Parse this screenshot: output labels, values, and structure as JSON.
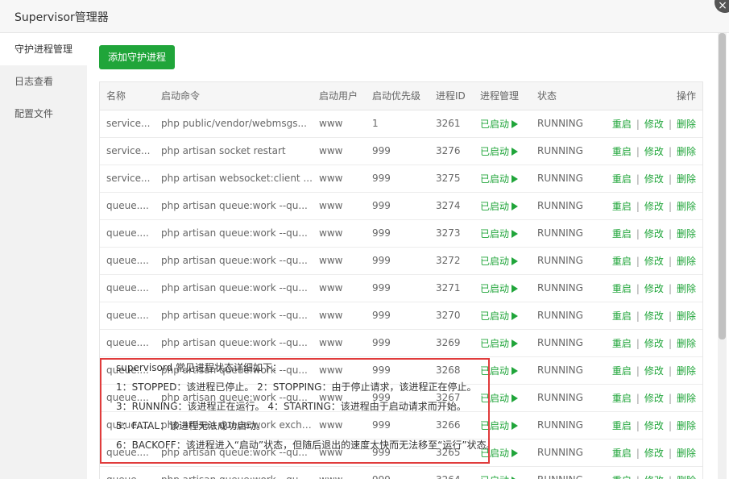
{
  "window": {
    "title": "Supervisor管理器",
    "close_icon": "×"
  },
  "sidebar": {
    "items": [
      {
        "label": "守护进程管理",
        "active": true
      },
      {
        "label": "日志查看"
      },
      {
        "label": "配置文件"
      }
    ]
  },
  "toolbar": {
    "add_label": "添加守护进程"
  },
  "table": {
    "headers": [
      "名称",
      "启动命令",
      "启动用户",
      "启动优先级",
      "进程ID",
      "进程管理",
      "状态",
      "操作"
    ],
    "ops": {
      "restart": "重启",
      "edit": "修改",
      "delete": "删除",
      "sep": "|"
    },
    "rows": [
      {
        "name": "service...",
        "cmd": "php public/vendor/webmsgs...",
        "user": "www",
        "priority": "1",
        "pid": "3261",
        "manage": "已启动",
        "status": "RUNNING"
      },
      {
        "name": "service...",
        "cmd": "php artisan socket restart",
        "user": "www",
        "priority": "999",
        "pid": "3276",
        "manage": "已启动",
        "status": "RUNNING"
      },
      {
        "name": "service...",
        "cmd": "php artisan websocket:client ...",
        "user": "www",
        "priority": "999",
        "pid": "3275",
        "manage": "已启动",
        "status": "RUNNING"
      },
      {
        "name": "queue....",
        "cmd": "php artisan queue:work --qu...",
        "user": "www",
        "priority": "999",
        "pid": "3274",
        "manage": "已启动",
        "status": "RUNNING"
      },
      {
        "name": "queue....",
        "cmd": "php artisan queue:work --qu...",
        "user": "www",
        "priority": "999",
        "pid": "3273",
        "manage": "已启动",
        "status": "RUNNING"
      },
      {
        "name": "queue....",
        "cmd": "php artisan queue:work --qu...",
        "user": "www",
        "priority": "999",
        "pid": "3272",
        "manage": "已启动",
        "status": "RUNNING"
      },
      {
        "name": "queue....",
        "cmd": "php artisan queue:work --qu...",
        "user": "www",
        "priority": "999",
        "pid": "3271",
        "manage": "已启动",
        "status": "RUNNING"
      },
      {
        "name": "queue....",
        "cmd": "php artisan queue:work --qu...",
        "user": "www",
        "priority": "999",
        "pid": "3270",
        "manage": "已启动",
        "status": "RUNNING"
      },
      {
        "name": "queue....",
        "cmd": "php artisan queue:work --qu...",
        "user": "www",
        "priority": "999",
        "pid": "3269",
        "manage": "已启动",
        "status": "RUNNING"
      },
      {
        "name": "queue....",
        "cmd": "php artisan queue:work --qu...",
        "user": "www",
        "priority": "999",
        "pid": "3268",
        "manage": "已启动",
        "status": "RUNNING"
      },
      {
        "name": "queue....",
        "cmd": "php artisan queue:work --qu...",
        "user": "www",
        "priority": "999",
        "pid": "3267",
        "manage": "已启动",
        "status": "RUNNING"
      },
      {
        "name": "queue....",
        "cmd": "php artisan queue:work exchan...",
        "user": "www",
        "priority": "999",
        "pid": "3266",
        "manage": "已启动",
        "status": "RUNNING"
      },
      {
        "name": "queue....",
        "cmd": "php artisan queue:work --qu...",
        "user": "www",
        "priority": "999",
        "pid": "3265",
        "manage": "已启动",
        "status": "RUNNING"
      },
      {
        "name": "queue....",
        "cmd": "php artisan queue:work --qu...",
        "user": "www",
        "priority": "999",
        "pid": "3264",
        "manage": "已启动",
        "status": "RUNNING"
      }
    ]
  },
  "note": {
    "lines": [
      "supervisord 常见进程状态详细如下：",
      "1：STOPPED：该进程已停止。    2：STOPPING：由于停止请求，该进程正在停止。",
      "3：RUNNING：该进程正在运行。  4：STARTING：该进程由于启动请求而开始。",
      "5：FATAL：该进程无法成功启动。",
      "6：BACKOFF：该进程进入“启动”状态，但随后退出的速度太快而无法移至“运行”状态。"
    ]
  },
  "colors": {
    "accent": "#20a53a",
    "highlight_border": "#e03c3c"
  }
}
